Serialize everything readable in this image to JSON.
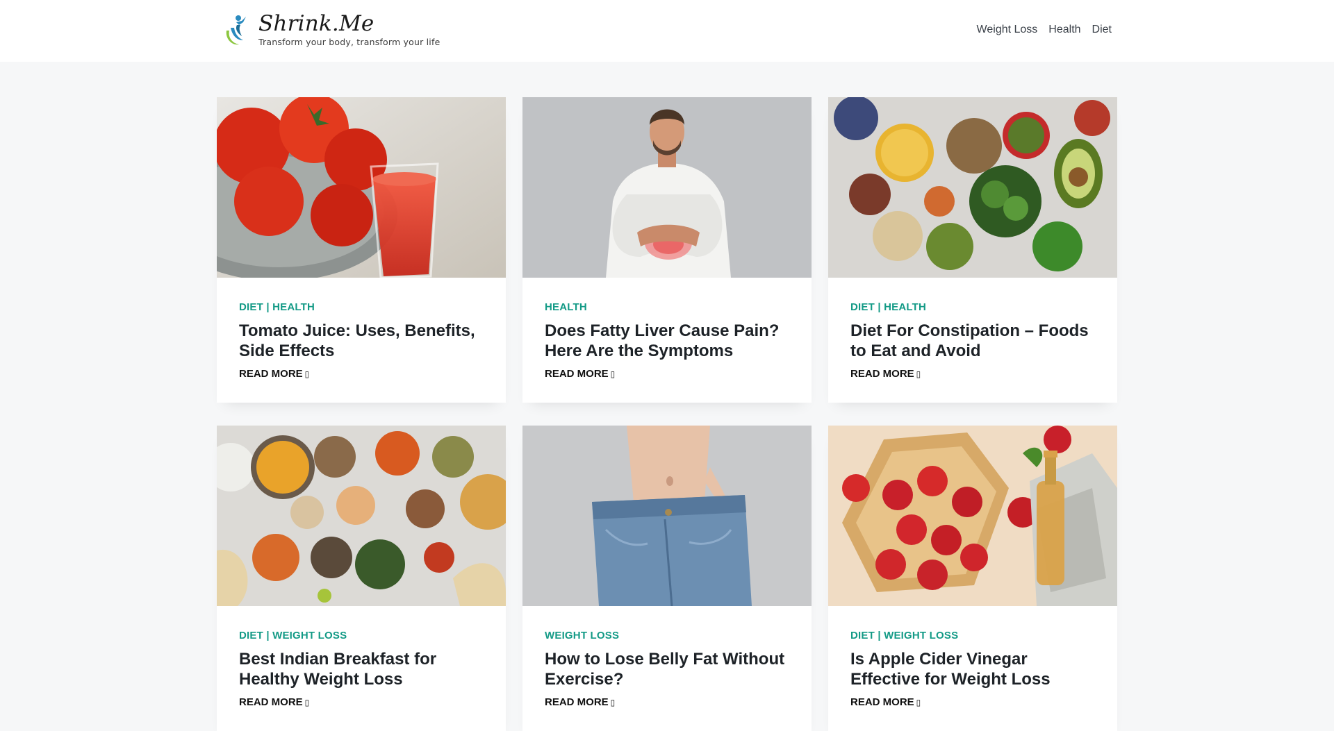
{
  "site": {
    "title": "Shrink.Me",
    "tagline": "Transform your body, transform your life"
  },
  "nav": {
    "items": [
      {
        "label": "Weight Loss"
      },
      {
        "label": "Health"
      },
      {
        "label": "Diet"
      }
    ]
  },
  "colors": {
    "accent": "#139a86",
    "page_bg": "#f6f7f8",
    "card_bg": "#ffffff"
  },
  "posts": [
    {
      "categories": "DIET | HEALTH",
      "title": "Tomato Juice: Uses, Benefits, Side Effects",
      "read_more": "READ MORE",
      "image": "tomato-juice-image"
    },
    {
      "categories": "HEALTH",
      "title": "Does Fatty Liver Cause Pain? Here Are the Symptoms",
      "read_more": "READ MORE",
      "image": "man-stomach-pain-image"
    },
    {
      "categories": "DIET | HEALTH",
      "title": "Diet For Constipation – Foods to Eat and Avoid",
      "read_more": "READ MORE",
      "image": "healthy-foods-bowls-image"
    },
    {
      "categories": "DIET | WEIGHT LOSS",
      "title": "Best Indian Breakfast for Healthy Weight Loss",
      "read_more": "READ MORE",
      "image": "indian-dishes-image"
    },
    {
      "categories": "WEIGHT LOSS",
      "title": "How to Lose Belly Fat Without Exercise?",
      "read_more": "READ MORE",
      "image": "loose-jeans-belly-image"
    },
    {
      "categories": "DIET | WEIGHT LOSS",
      "title": "Is Apple Cider Vinegar Effective for Weight Loss",
      "read_more": "READ MORE",
      "image": "apples-vinegar-image"
    }
  ]
}
